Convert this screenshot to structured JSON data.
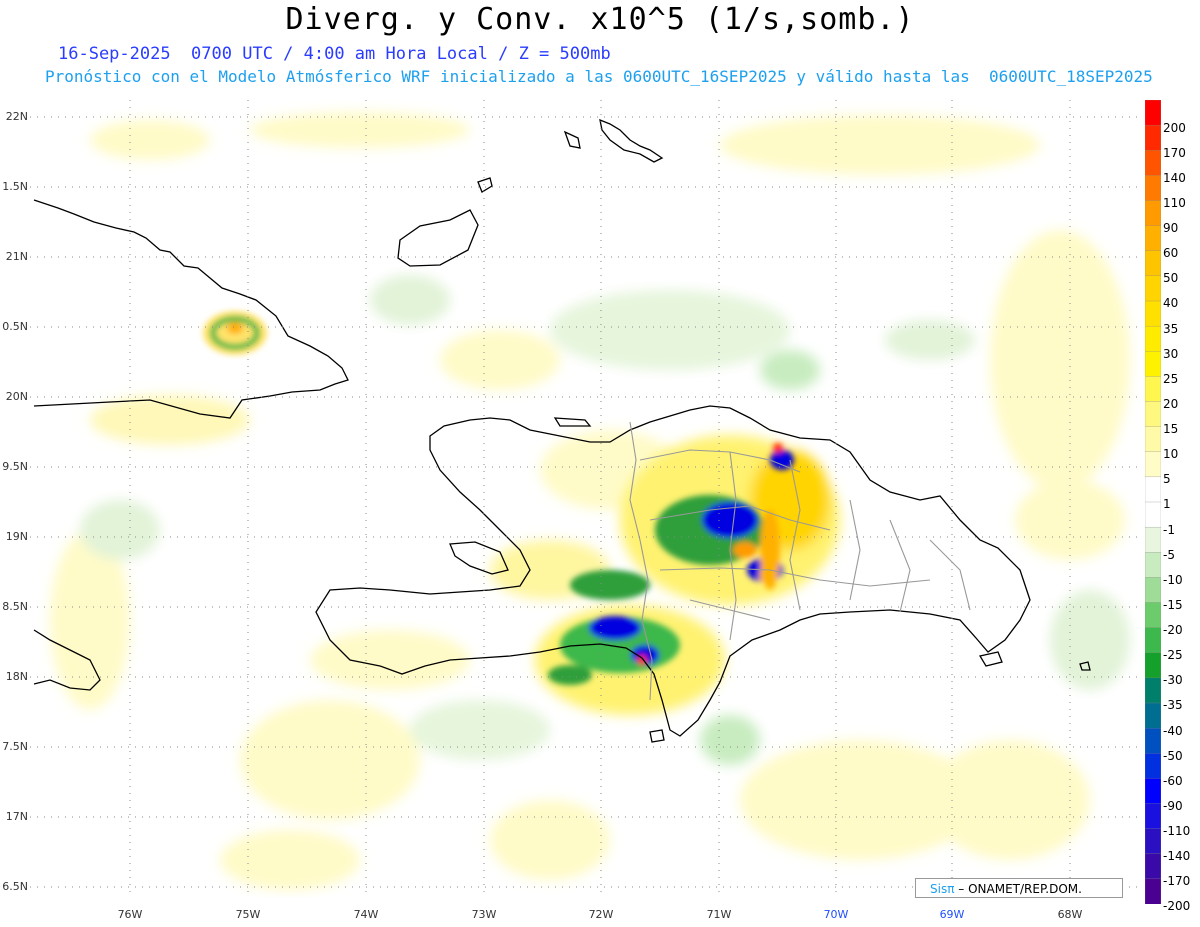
{
  "title": "Diverg. y Conv. x10^5 (1/s,somb.)",
  "subtitle_1": "16-Sep-2025  0700 UTC / 4:00 am Hora Local / Z = 500mb",
  "subtitle_2": "Pronóstico con el Modelo Atmósferico WRF inicializado a las 0600UTC_16SEP2025 y válido hasta las  0600UTC_18SEP2025",
  "lat_labels": [
    "22N",
    "1.5N",
    "21N",
    "0.5N",
    "20N",
    "9.5N",
    "19N",
    "8.5N",
    "18N",
    "7.5N",
    "17N",
    "6.5N"
  ],
  "lon_labels": [
    "76W",
    "75W",
    "74W",
    "73W",
    "72W",
    "71W",
    "70W",
    "69W",
    "68W"
  ],
  "colorbar": {
    "labels": [
      "200",
      "170",
      "140",
      "110",
      "90",
      "60",
      "50",
      "40",
      "35",
      "30",
      "25",
      "20",
      "15",
      "10",
      "5",
      "1",
      "-1",
      "-5",
      "-10",
      "-15",
      "-20",
      "-25",
      "-30",
      "-35",
      "-40",
      "-50",
      "-60",
      "-90",
      "-110",
      "-140",
      "-170",
      "-200"
    ],
    "colors": [
      "#ff0000",
      "#ff2a00",
      "#ff5500",
      "#ff7a00",
      "#ff9a00",
      "#ffb000",
      "#ffc400",
      "#ffd400",
      "#ffe000",
      "#ffeb00",
      "#fff200",
      "#fff650",
      "#fff880",
      "#fffaa8",
      "#fffcc8",
      "#ffffff",
      "#ffffff",
      "#e8f6e0",
      "#c8ecc0",
      "#9edc98",
      "#6ccc6c",
      "#3cb84c",
      "#14a02a",
      "#00806a",
      "#006e90",
      "#0050c0",
      "#0030e0",
      "#0000ff",
      "#1a10e0",
      "#2a10c0",
      "#3a0aa8",
      "#4a0090"
    ]
  },
  "credit": {
    "sis": "Sisπ",
    "rest": "– ONAMET/REP.DOM."
  }
}
